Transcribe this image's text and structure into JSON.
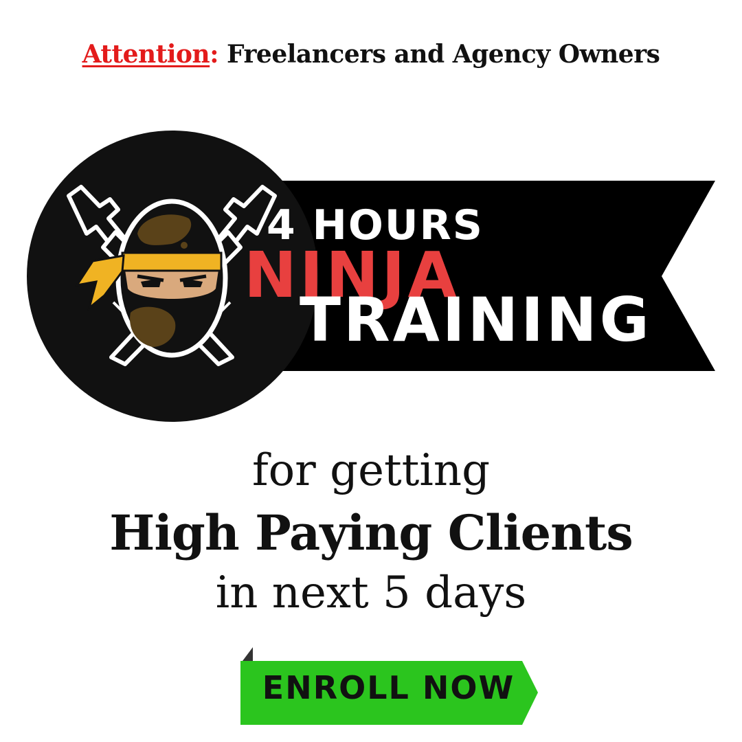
{
  "header": {
    "attention_word": "Attention",
    "attention_colon": ":",
    "audience": " Freelancers and Agency Owners"
  },
  "logo": {
    "line1": "4 HOURS",
    "line2": "NINJA",
    "line3": "TRAINING"
  },
  "subtitle": {
    "line1": "for getting",
    "line2": "High Paying Clients",
    "line3": "in next 5 days"
  },
  "cta": {
    "label": "ENROLL NOW"
  },
  "colors": {
    "accent_red": "#e31b1b",
    "ninja_red": "#e8403f",
    "banner_black": "#000000",
    "headband_yellow": "#f0b323",
    "cta_green": "#2bc51e"
  },
  "icons": [
    "ninja-mascot-icon",
    "crossed-swords-icon"
  ]
}
